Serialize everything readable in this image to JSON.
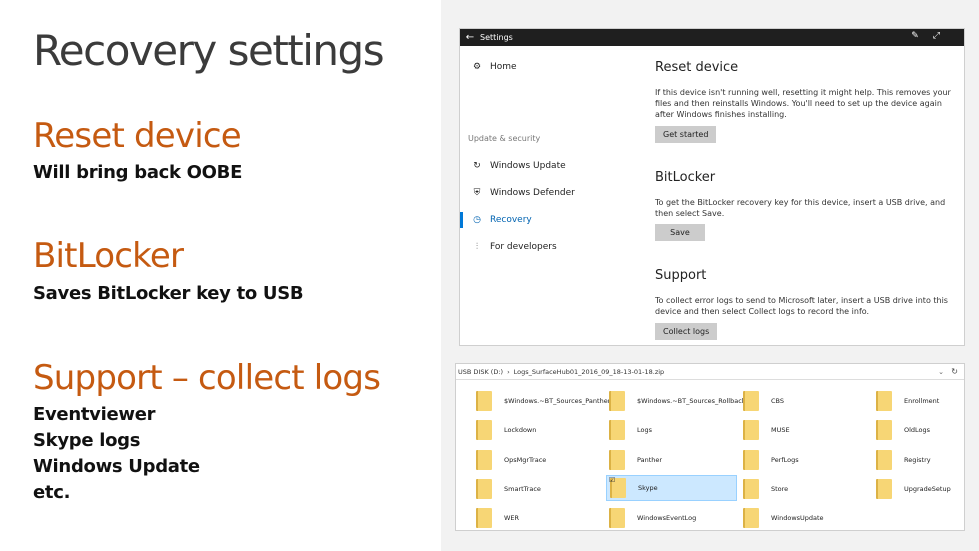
{
  "slide": {
    "title": "Recovery settings",
    "sections": [
      {
        "heading": "Reset device",
        "bullets": [
          "Will bring back OOBE"
        ]
      },
      {
        "heading": "BitLocker",
        "bullets": [
          "Saves BitLocker key to USB"
        ]
      },
      {
        "heading": "Support – collect logs",
        "bullets": [
          "Eventviewer",
          "Skype logs",
          "Windows Update",
          "etc."
        ]
      }
    ]
  },
  "settings": {
    "window_title": "Settings",
    "nav": {
      "home": "Home",
      "group": "Update & security",
      "items": [
        "Windows Update",
        "Windows Defender",
        "Recovery",
        "For developers"
      ],
      "selected": "Recovery"
    },
    "reset": {
      "heading": "Reset device",
      "text": "If this device isn't running well, resetting it might help. This removes your files and then reinstalls Windows. You'll need to set up the device again after Windows finishes installing.",
      "button": "Get started"
    },
    "bitlocker": {
      "heading": "BitLocker",
      "text": "To get the BitLocker recovery key for this device, insert a USB drive, and then select Save.",
      "button": "Save"
    },
    "support": {
      "heading": "Support",
      "text": "To collect error logs to send to Microsoft later, insert a USB drive into this device and then select Collect logs to record the info.",
      "button": "Collect logs"
    }
  },
  "explorer": {
    "path": [
      "USB DISK (D:)",
      "Logs_SurfaceHub01_2016_09_18-13-01-18.zip"
    ],
    "folders": [
      [
        "$Windows.~BT_Sources_Panther",
        "$Windows.~BT_Sources_Rollback",
        "CBS",
        "Enrollment"
      ],
      [
        "Lockdown",
        "Logs",
        "MUSE",
        "OldLogs"
      ],
      [
        "OpsMgrTrace",
        "Panther",
        "PerfLogs",
        "Registry"
      ],
      [
        "SmartTrace",
        "Skype",
        "Store",
        "UpgradeSetup"
      ],
      [
        "WER",
        "WindowsEventLog",
        "WindowsUpdate"
      ]
    ],
    "selected": "Skype"
  }
}
